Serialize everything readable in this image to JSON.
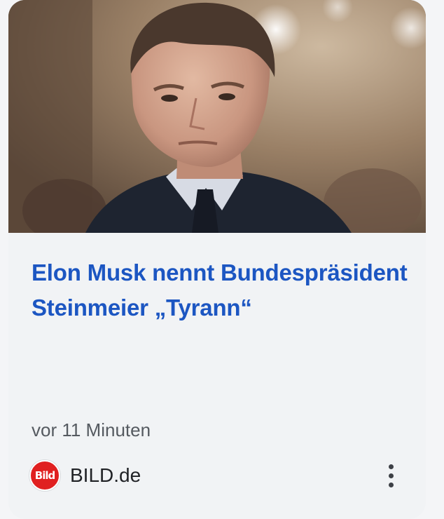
{
  "article": {
    "title": "Elon Musk nennt Bundespräsident Steinmeier „Tyrann“",
    "time_ago": "vor 11 Minuten",
    "image_icon": "news-photo-portrait"
  },
  "source": {
    "name": "BILD.de",
    "logo_text": "Bild",
    "logo_color": "#e02020"
  },
  "menu": {
    "icon": "more-vert-icon"
  },
  "colors": {
    "title": "#1c56c2",
    "card_background": "#f1f3f5"
  }
}
